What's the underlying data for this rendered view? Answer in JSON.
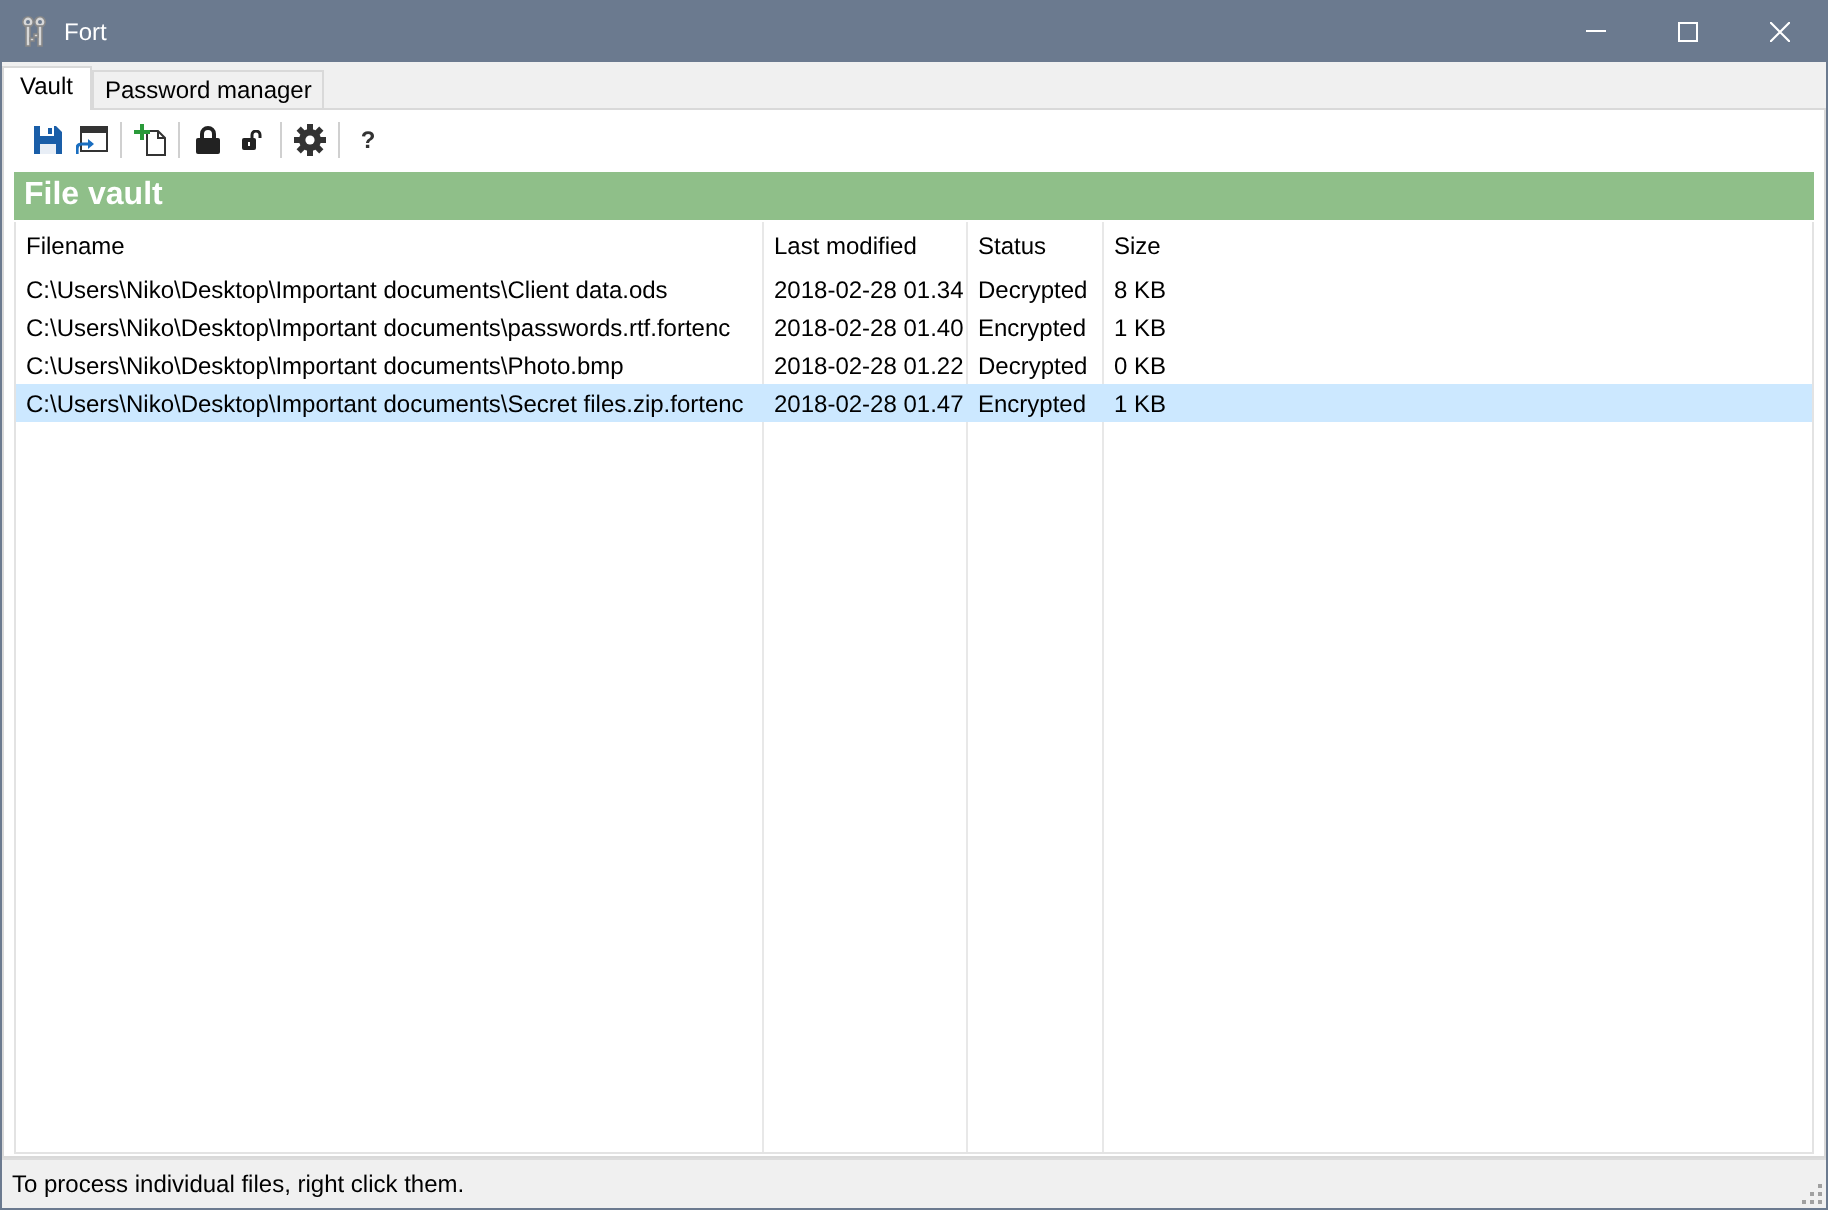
{
  "window": {
    "title": "Fort"
  },
  "tabs": [
    {
      "label": "Vault",
      "selected": true
    },
    {
      "label": "Password manager",
      "selected": false
    }
  ],
  "toolbar": {
    "help_button": "?"
  },
  "panel": {
    "title": "File vault"
  },
  "table": {
    "columns": [
      "Filename",
      "Last modified",
      "Status",
      "Size"
    ],
    "rows": [
      {
        "cells": [
          "C:\\Users\\Niko\\Desktop\\Important documents\\Client data.ods",
          "2018-02-28 01.34",
          "Decrypted",
          "8 KB"
        ],
        "selected": false
      },
      {
        "cells": [
          "C:\\Users\\Niko\\Desktop\\Important documents\\passwords.rtf.fortenc",
          "2018-02-28 01.40",
          "Encrypted",
          "1 KB"
        ],
        "selected": false
      },
      {
        "cells": [
          "C:\\Users\\Niko\\Desktop\\Important documents\\Photo.bmp",
          "2018-02-28 01.22",
          "Decrypted",
          "0 KB"
        ],
        "selected": false
      },
      {
        "cells": [
          "C:\\Users\\Niko\\Desktop\\Important documents\\Secret files.zip.fortenc",
          "2018-02-28 01.47",
          "Encrypted",
          "1 KB"
        ],
        "selected": true
      }
    ]
  },
  "status_bar": "To process individual files, right click them."
}
